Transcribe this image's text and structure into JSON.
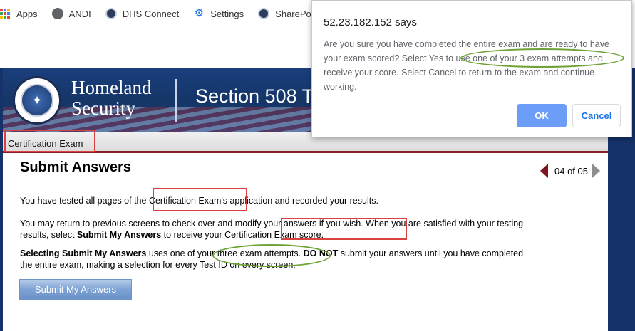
{
  "bookmarks": [
    {
      "label": "Apps",
      "icon": "apps-grid-icon"
    },
    {
      "label": "ANDI",
      "icon": "globe-icon"
    },
    {
      "label": "DHS Connect",
      "icon": "dhs-seal-icon"
    },
    {
      "label": "Settings",
      "icon": "gear-icon"
    },
    {
      "label": "SharePoint Auth",
      "icon": "dhs-seal-icon"
    }
  ],
  "header": {
    "agency_line1": "Homeland",
    "agency_line2": "Security",
    "section_title": "Section 508 T"
  },
  "subbar": {
    "label": "Certification Exam"
  },
  "main": {
    "title": "Submit Answers",
    "pager": "04 of 05",
    "p1_before": "You have tested all pages of the ",
    "p1_highlight": "Certification Exam's",
    "p1_after": " application and recorded your results.",
    "p2_a": "You may return to previous screens to check over and modify your answers if you wish. When you are satisfied with your testing results, select ",
    "p2_bold": "Submit My Answers",
    "p2_b": " to receive your Certification Exam score.",
    "p3_bold1": "Selecting Submit My Answers",
    "p3_a": " uses one of your three exam attempts. ",
    "p3_bold2": "DO NOT",
    "p3_b": " submit your answers until you have completed the entire exam, making a selection for every Test ID on every screen.",
    "submit_label": "Submit My Answers"
  },
  "dialog": {
    "title": "52.23.182.152 says",
    "message": "Are you sure you have completed the entire exam and are ready to have your exam scored? Select Yes to use one of your 3 exam attempts and receive your score. Select Cancel to return to the exam and continue working.",
    "ok_label": "OK",
    "cancel_label": "Cancel"
  },
  "colors": {
    "banner": "#153566",
    "accent_red": "#8a1c27",
    "annotation_red": "#d9423f",
    "annotation_green": "#6ea236",
    "ok_button": "#6c9ef8"
  }
}
